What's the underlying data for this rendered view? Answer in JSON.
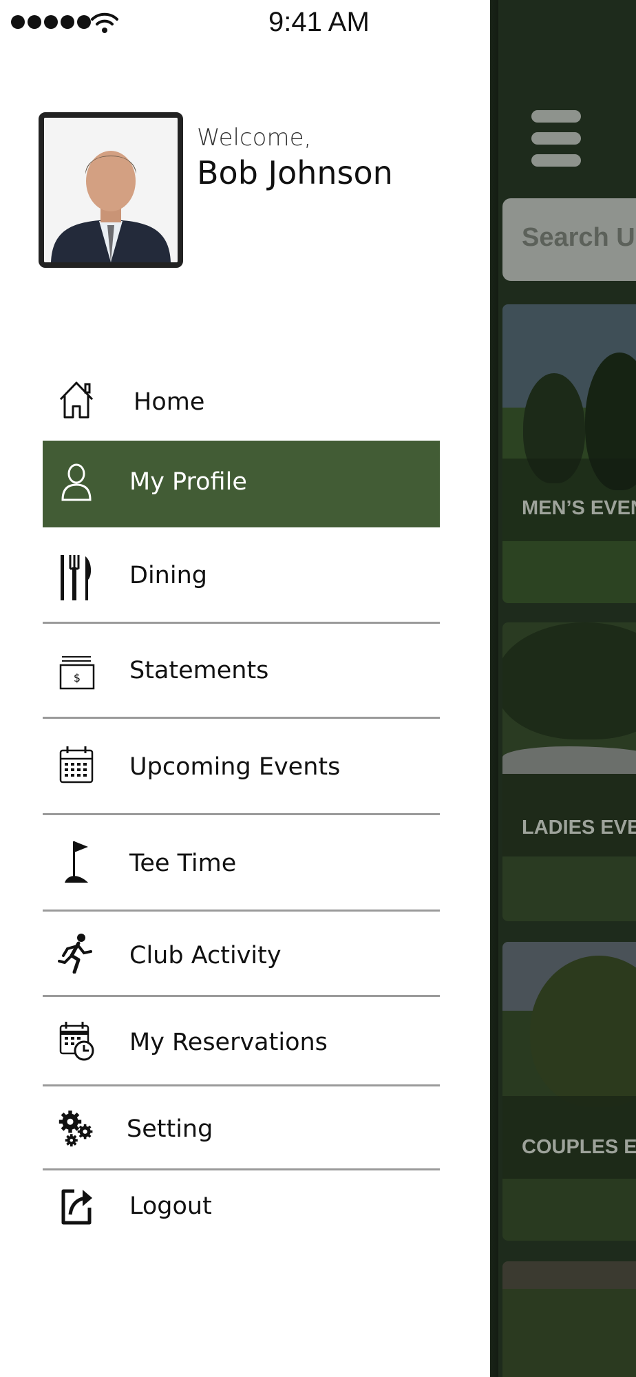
{
  "status_bar": {
    "time": "9:41 AM",
    "signal_icon": "signal-dots-icon",
    "wifi_icon": "wifi-icon"
  },
  "profile": {
    "welcome": "Welcome,",
    "name": "Bob Johnson"
  },
  "menu": {
    "items": [
      {
        "label": "Home",
        "icon": "home-icon",
        "active": false
      },
      {
        "label": "My Profile",
        "icon": "person-icon",
        "active": true
      },
      {
        "label": "Dining",
        "icon": "fork-knife-icon",
        "active": false
      },
      {
        "label": "Statements",
        "icon": "statement-icon",
        "active": false
      },
      {
        "label": "Upcoming Events",
        "icon": "calendar-icon",
        "active": false
      },
      {
        "label": "Tee Time",
        "icon": "golf-flag-icon",
        "active": false
      },
      {
        "label": "Club Activity",
        "icon": "runner-icon",
        "active": false
      },
      {
        "label": "My Reservations",
        "icon": "calendar-clock-icon",
        "active": false
      },
      {
        "label": "Setting",
        "icon": "gears-icon",
        "active": false
      },
      {
        "label": "Logout",
        "icon": "logout-icon",
        "active": false
      }
    ]
  },
  "background": {
    "search_placeholder": "Search Up",
    "events": [
      "MEN’S EVEN",
      "LADIES EVE",
      "COUPLES EV"
    ]
  },
  "colors": {
    "accent": "#425c35",
    "app_background": "#1e2b1c"
  }
}
